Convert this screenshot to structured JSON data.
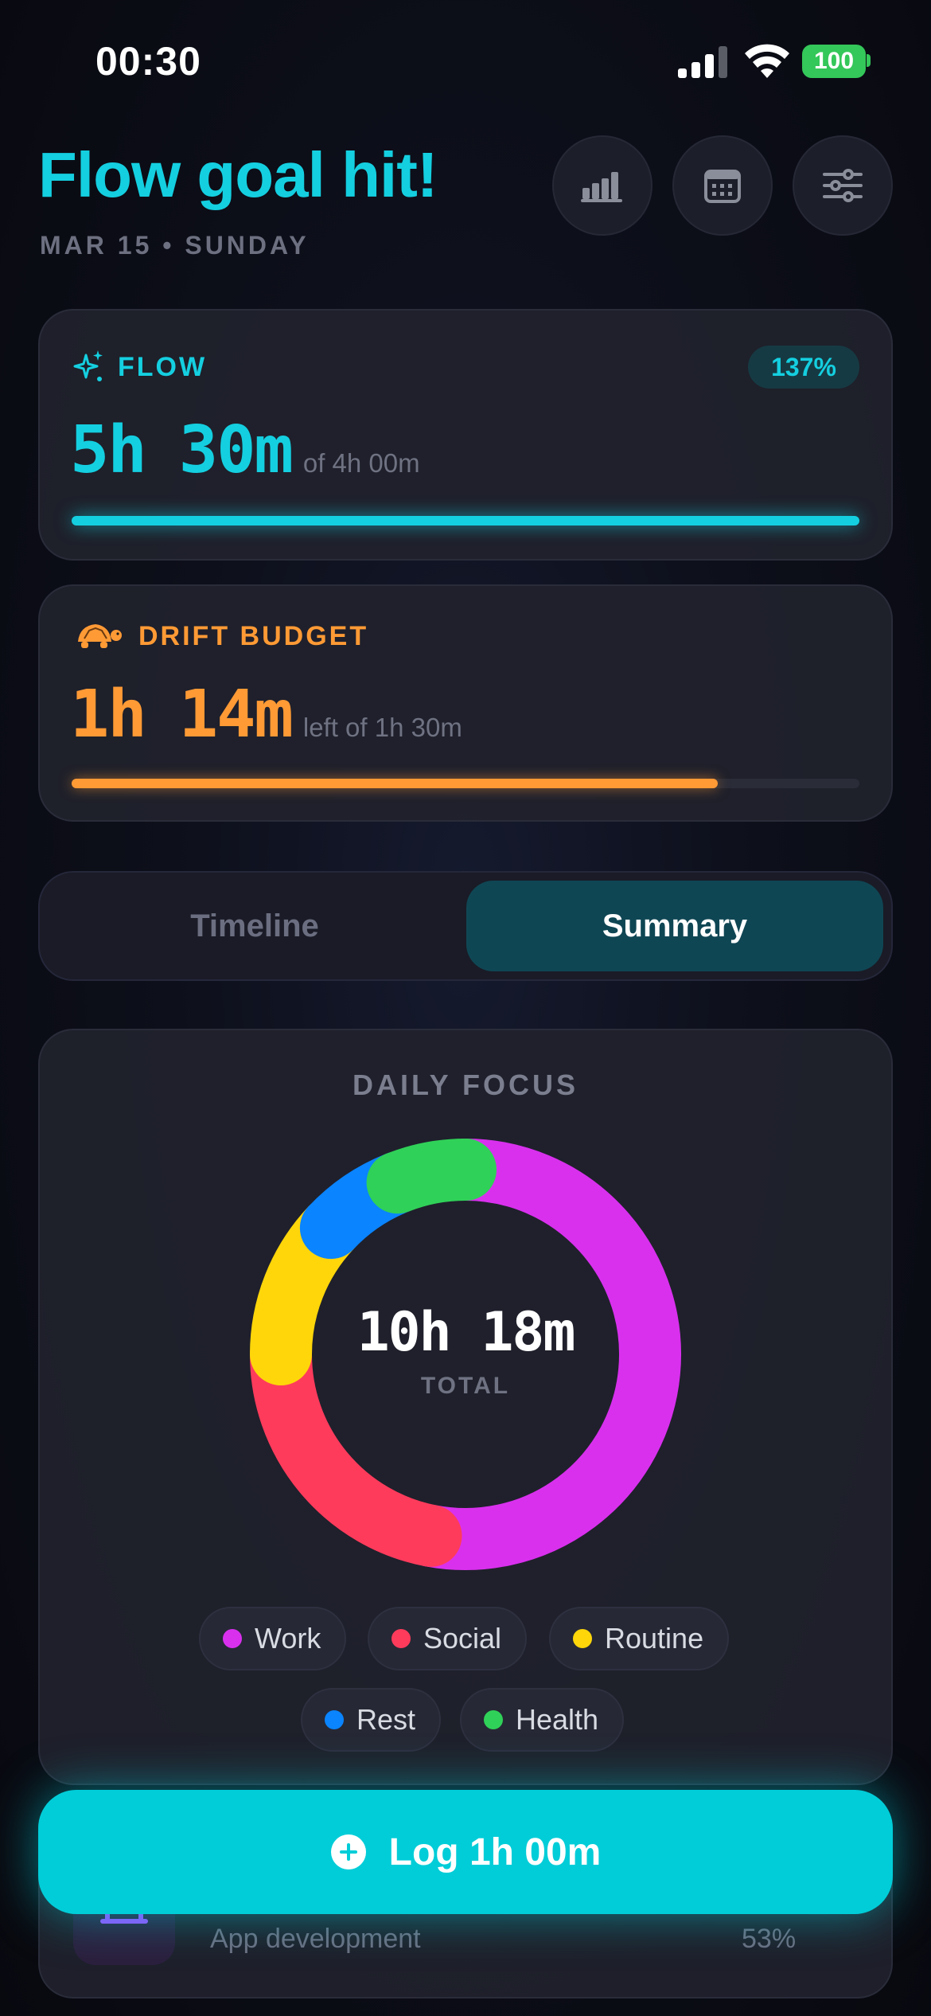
{
  "status": {
    "time": "00:30",
    "battery": "100"
  },
  "header": {
    "title": "Flow goal hit!",
    "subtitle": "MAR 15 • SUNDAY"
  },
  "flow": {
    "label": "FLOW",
    "value_h": "5h",
    "value_m": "30m",
    "of_text": "of 4h 00m",
    "badge": "137%",
    "progress": 1.0,
    "color": "#14cfe0"
  },
  "drift": {
    "label": "DRIFT BUDGET",
    "value_h": "1h",
    "value_m": "14m",
    "of_text": "left of 1h 30m",
    "progress": 0.82,
    "color": "#ff9a35"
  },
  "tabs": {
    "timeline": "Timeline",
    "summary": "Summary",
    "active": "summary"
  },
  "focus": {
    "label": "DAILY FOCUS",
    "total": "10h 18m",
    "total_label": "TOTAL",
    "legend": [
      {
        "name": "Work",
        "color": "#d930ee"
      },
      {
        "name": "Social",
        "color": "#ff3b5c"
      },
      {
        "name": "Routine",
        "color": "#ffd60a"
      },
      {
        "name": "Rest",
        "color": "#0a84ff"
      },
      {
        "name": "Health",
        "color": "#30d158"
      }
    ]
  },
  "chart_data": {
    "type": "pie",
    "categories": [
      "Work",
      "Social",
      "Routine",
      "Rest",
      "Health"
    ],
    "values": [
      53,
      22,
      12,
      7,
      6
    ]
  },
  "list": {
    "subtitle": "App development",
    "percent": "53%"
  },
  "cta": {
    "label": "Log 1h 00m"
  }
}
